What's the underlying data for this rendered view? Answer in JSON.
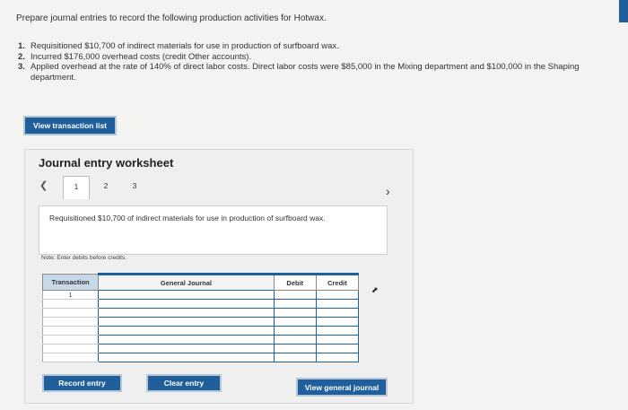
{
  "instruction": "Prepare journal entries to record the following production activities for Hotwax.",
  "steps": [
    {
      "num": "1.",
      "text": "Requisitioned $10,700 of indirect materials for use in production of surfboard wax."
    },
    {
      "num": "2.",
      "text": "Incurred $176,000 overhead costs (credit Other accounts)."
    },
    {
      "num": "3.",
      "text": "Applied overhead at the rate of 140% of direct labor costs. Direct labor costs were $85,000 in the Mixing department and $100,000 in the Shaping department."
    }
  ],
  "view_transaction_list": "View transaction list",
  "worksheet": {
    "title": "Journal entry worksheet",
    "prev_icon": "chevron-left",
    "next_icon": "chevron-right",
    "tabs": [
      "1",
      "2",
      "3"
    ],
    "description": "Requisitioned $10,700 of indirect materials for use in production of surfboard wax.",
    "note": "Note: Enter debits before credits.",
    "table": {
      "headers": {
        "transaction": "Transaction",
        "general_journal": "General Journal",
        "debit": "Debit",
        "credit": "Credit"
      },
      "first_transaction": "1"
    },
    "buttons": {
      "record": "Record entry",
      "clear": "Clear entry",
      "view_general": "View general journal"
    }
  },
  "colors": {
    "accent": "#1f5f9c",
    "header_bg": "#c7d8e8",
    "page_bg": "#f3f3f1"
  }
}
